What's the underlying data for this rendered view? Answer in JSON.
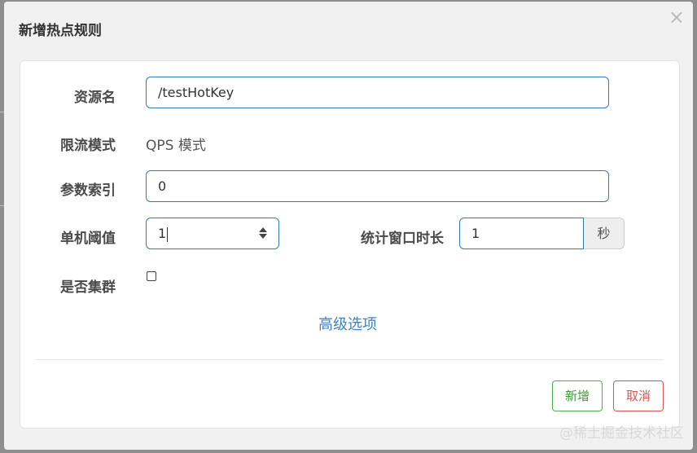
{
  "dialog": {
    "title": "新增热点规则",
    "close_glyph": "×"
  },
  "form": {
    "resource_name": {
      "label": "资源名",
      "value": "/testHotKey"
    },
    "limit_mode": {
      "label": "限流模式",
      "value": "QPS 模式"
    },
    "param_index": {
      "label": "参数索引",
      "value": "0"
    },
    "threshold": {
      "label": "单机阈值",
      "value": "1"
    },
    "window": {
      "label": "统计窗口时长",
      "value": "1",
      "unit": "秒"
    },
    "cluster": {
      "label": "是否集群",
      "checked": false
    },
    "advanced_link": "高级选项"
  },
  "footer": {
    "add_label": "新增",
    "cancel_label": "取消"
  },
  "watermark": "@稀土掘金技术社区",
  "colors": {
    "input_border": "#3478b8",
    "add_button": "#4cae4c",
    "cancel_button": "#d9534f",
    "link": "#3a83c4"
  }
}
